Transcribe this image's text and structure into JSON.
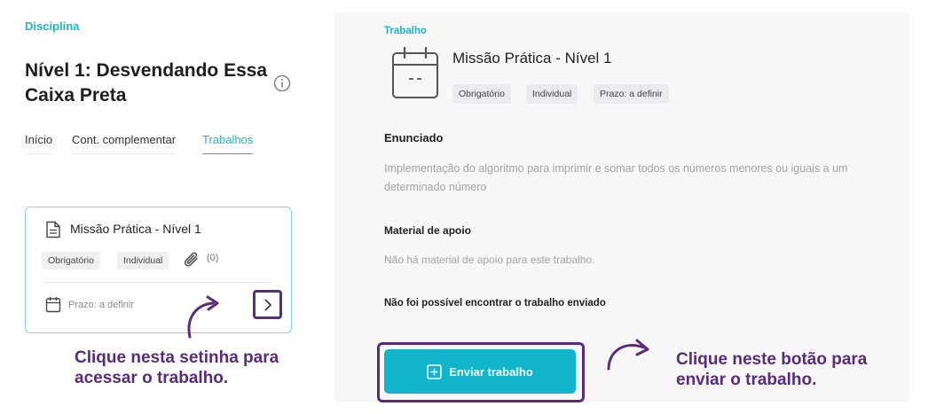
{
  "left": {
    "discipline_label": "Disciplina",
    "course_title": "Nível 1: Desvendando Essa Caixa Preta",
    "tabs": [
      {
        "label": "Início"
      },
      {
        "label": "Cont. complementar"
      },
      {
        "label": "Trabalhos",
        "active": true
      }
    ],
    "card": {
      "title": "Missão Prática - Nível 1",
      "badges": [
        "Obrigatório",
        "Individual"
      ],
      "attachments_count": "(0)",
      "deadline": "Prazo: a definir"
    },
    "hint": "Clique nesta setinha para acessar o trabalho."
  },
  "right": {
    "section_label": "Trabalho",
    "title": "Missão Prática - Nível 1",
    "badges": [
      "Obrigatório",
      "Individual",
      "Prazo: a definir"
    ],
    "enunciado_heading": "Enunciado",
    "enunciado_text": "Implementação do algoritmo para imprimir e somar todos os números menores ou iguais a um determinado número",
    "material_heading": "Material de apoio",
    "material_text": "Não há material de apoio para este trabalho.",
    "not_found_text": "Não foi possível encontrar o trabalho enviado",
    "send_button_label": "Enviar trabalho",
    "hint": "Clique neste botão para enviar o trabalho."
  },
  "icons": {
    "info": "info-icon",
    "document": "document-icon",
    "paperclip": "paperclip-icon",
    "calendar": "calendar-icon",
    "chevron": "chevron-right-icon",
    "plus": "plus-square-icon"
  },
  "colors": {
    "accent": "#1db5c9",
    "button": "#12b4cc",
    "annotation": "#5a2a7c",
    "panel_bg": "#f7f7f8"
  }
}
